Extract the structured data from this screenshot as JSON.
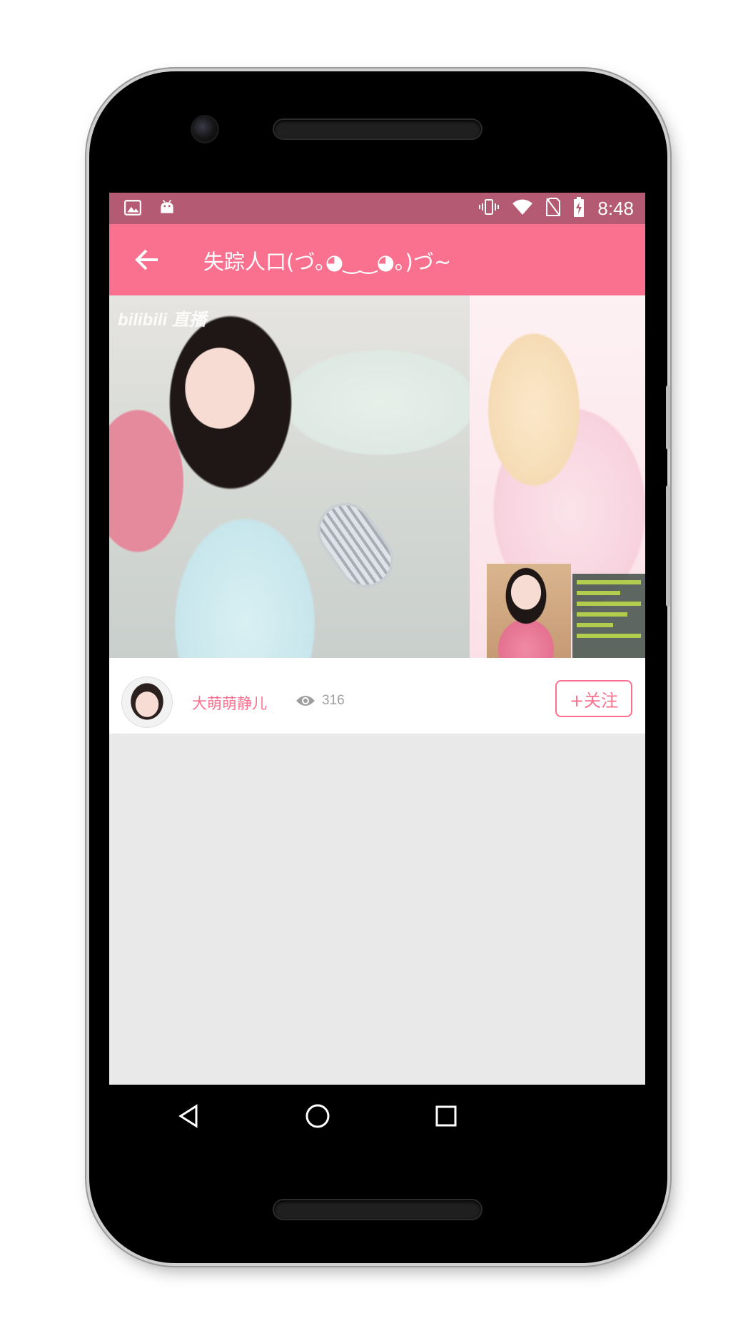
{
  "status_bar": {
    "time": "8:48",
    "left_icons": [
      "image-icon",
      "android-icon"
    ],
    "right_icons": [
      "vibrate-icon",
      "wifi-icon",
      "no-sim-icon",
      "battery-charging-icon"
    ]
  },
  "toolbar": {
    "title": "失踪人口(づ｡◕‿‿◕｡)づ~",
    "back_icon": "arrow-back-icon",
    "background_color": "#f9718f"
  },
  "stream": {
    "cover_alt_marks": [
      "bilibili 直播"
    ]
  },
  "streamer": {
    "name": "大萌萌静儿",
    "views": "316",
    "follow_label": "+关注"
  },
  "nav_bar": {
    "buttons": [
      "back-triangle-icon",
      "home-circle-icon",
      "recents-square-icon"
    ]
  },
  "colors": {
    "accent": "#f9718f",
    "status_bar": "#b45a72",
    "content_bg": "#e9e9e9"
  }
}
